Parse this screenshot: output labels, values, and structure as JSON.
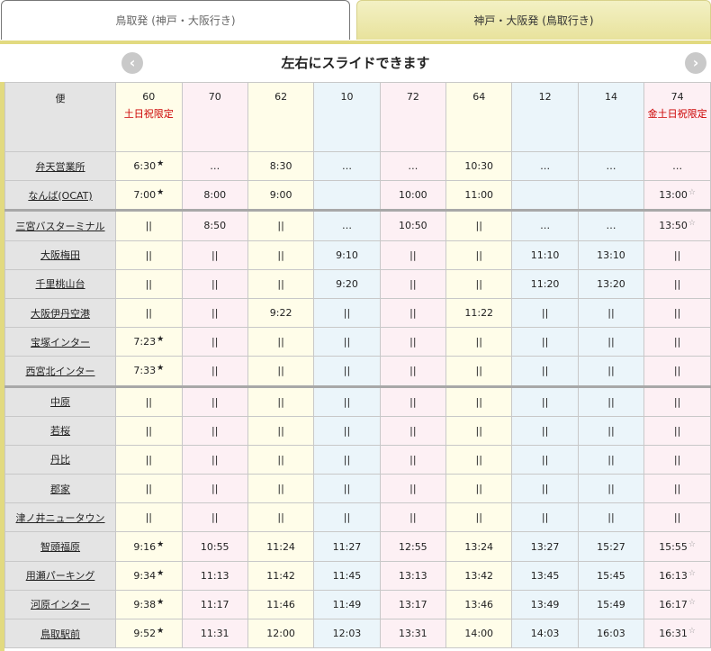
{
  "tabs": [
    {
      "label": "鳥取発 (神戸・大阪行き)",
      "active": false
    },
    {
      "label": "神戸・大阪発 (鳥取行き)",
      "active": true
    }
  ],
  "slide_hint": "左右にスライドできます",
  "icons": {
    "prev": "chevron-left-icon",
    "next": "chevron-right-icon"
  },
  "colors": {
    "accent_gold": "#e2da80",
    "note_red": "#cc0000",
    "yellow_col": "#fffde9",
    "pink_col": "#fdf0f4",
    "blue_col": "#ebf5fa"
  },
  "table": {
    "corner_label": "便",
    "columns": [
      {
        "number": "60",
        "note": "土日祝限定",
        "tint": "y"
      },
      {
        "number": "70",
        "note": "",
        "tint": "p"
      },
      {
        "number": "62",
        "note": "",
        "tint": "y"
      },
      {
        "number": "10",
        "note": "",
        "tint": "b"
      },
      {
        "number": "72",
        "note": "",
        "tint": "p"
      },
      {
        "number": "64",
        "note": "",
        "tint": "y"
      },
      {
        "number": "12",
        "note": "",
        "tint": "b"
      },
      {
        "number": "14",
        "note": "",
        "tint": "b"
      },
      {
        "number": "74",
        "note": "金土日祝限定",
        "tint": "p"
      }
    ],
    "rows": [
      {
        "stop": "弁天営業所",
        "times": [
          "6:30★",
          "…",
          "8:30",
          "…",
          "…",
          "10:30",
          "…",
          "…",
          "…"
        ]
      },
      {
        "stop": "なんば(OCAT)",
        "times": [
          "7:00★",
          "8:00",
          "9:00",
          "",
          "10:00",
          "11:00",
          "",
          "",
          "13:00☆"
        ]
      },
      {
        "stop": "三宮バスターミナル",
        "times": [
          "||",
          "8:50",
          "||",
          "…",
          "10:50",
          "||",
          "…",
          "…",
          "13:50☆"
        ],
        "sep": true
      },
      {
        "stop": "大阪梅田",
        "times": [
          "||",
          "||",
          "||",
          "9:10",
          "||",
          "||",
          "11:10",
          "13:10",
          "||"
        ]
      },
      {
        "stop": "千里桃山台",
        "times": [
          "||",
          "||",
          "||",
          "9:20",
          "||",
          "||",
          "11:20",
          "13:20",
          "||"
        ]
      },
      {
        "stop": "大阪伊丹空港",
        "times": [
          "||",
          "||",
          "9:22",
          "||",
          "||",
          "11:22",
          "||",
          "||",
          "||"
        ]
      },
      {
        "stop": "宝塚インター",
        "times": [
          "7:23★",
          "||",
          "||",
          "||",
          "||",
          "||",
          "||",
          "||",
          "||"
        ]
      },
      {
        "stop": "西宮北インター",
        "times": [
          "7:33★",
          "||",
          "||",
          "||",
          "||",
          "||",
          "||",
          "||",
          "||"
        ]
      },
      {
        "stop": "中原",
        "times": [
          "||",
          "||",
          "||",
          "||",
          "||",
          "||",
          "||",
          "||",
          "||"
        ],
        "sep": true
      },
      {
        "stop": "若桜",
        "times": [
          "||",
          "||",
          "||",
          "||",
          "||",
          "||",
          "||",
          "||",
          "||"
        ]
      },
      {
        "stop": "丹比",
        "times": [
          "||",
          "||",
          "||",
          "||",
          "||",
          "||",
          "||",
          "||",
          "||"
        ]
      },
      {
        "stop": "郡家",
        "times": [
          "||",
          "||",
          "||",
          "||",
          "||",
          "||",
          "||",
          "||",
          "||"
        ]
      },
      {
        "stop": "津ノ井ニュータウン",
        "times": [
          "||",
          "||",
          "||",
          "||",
          "||",
          "||",
          "||",
          "||",
          "||"
        ]
      },
      {
        "stop": "智頭福原",
        "times": [
          "9:16★",
          "10:55",
          "11:24",
          "11:27",
          "12:55",
          "13:24",
          "13:27",
          "15:27",
          "15:55☆"
        ]
      },
      {
        "stop": "用瀬パーキング",
        "times": [
          "9:34★",
          "11:13",
          "11:42",
          "11:45",
          "13:13",
          "13:42",
          "13:45",
          "15:45",
          "16:13☆"
        ]
      },
      {
        "stop": "河原インター",
        "times": [
          "9:38★",
          "11:17",
          "11:46",
          "11:49",
          "13:17",
          "13:46",
          "13:49",
          "15:49",
          "16:17☆"
        ]
      },
      {
        "stop": "鳥取駅前",
        "times": [
          "9:52★",
          "11:31",
          "12:00",
          "12:03",
          "13:31",
          "14:00",
          "14:03",
          "16:03",
          "16:31☆"
        ]
      }
    ]
  }
}
